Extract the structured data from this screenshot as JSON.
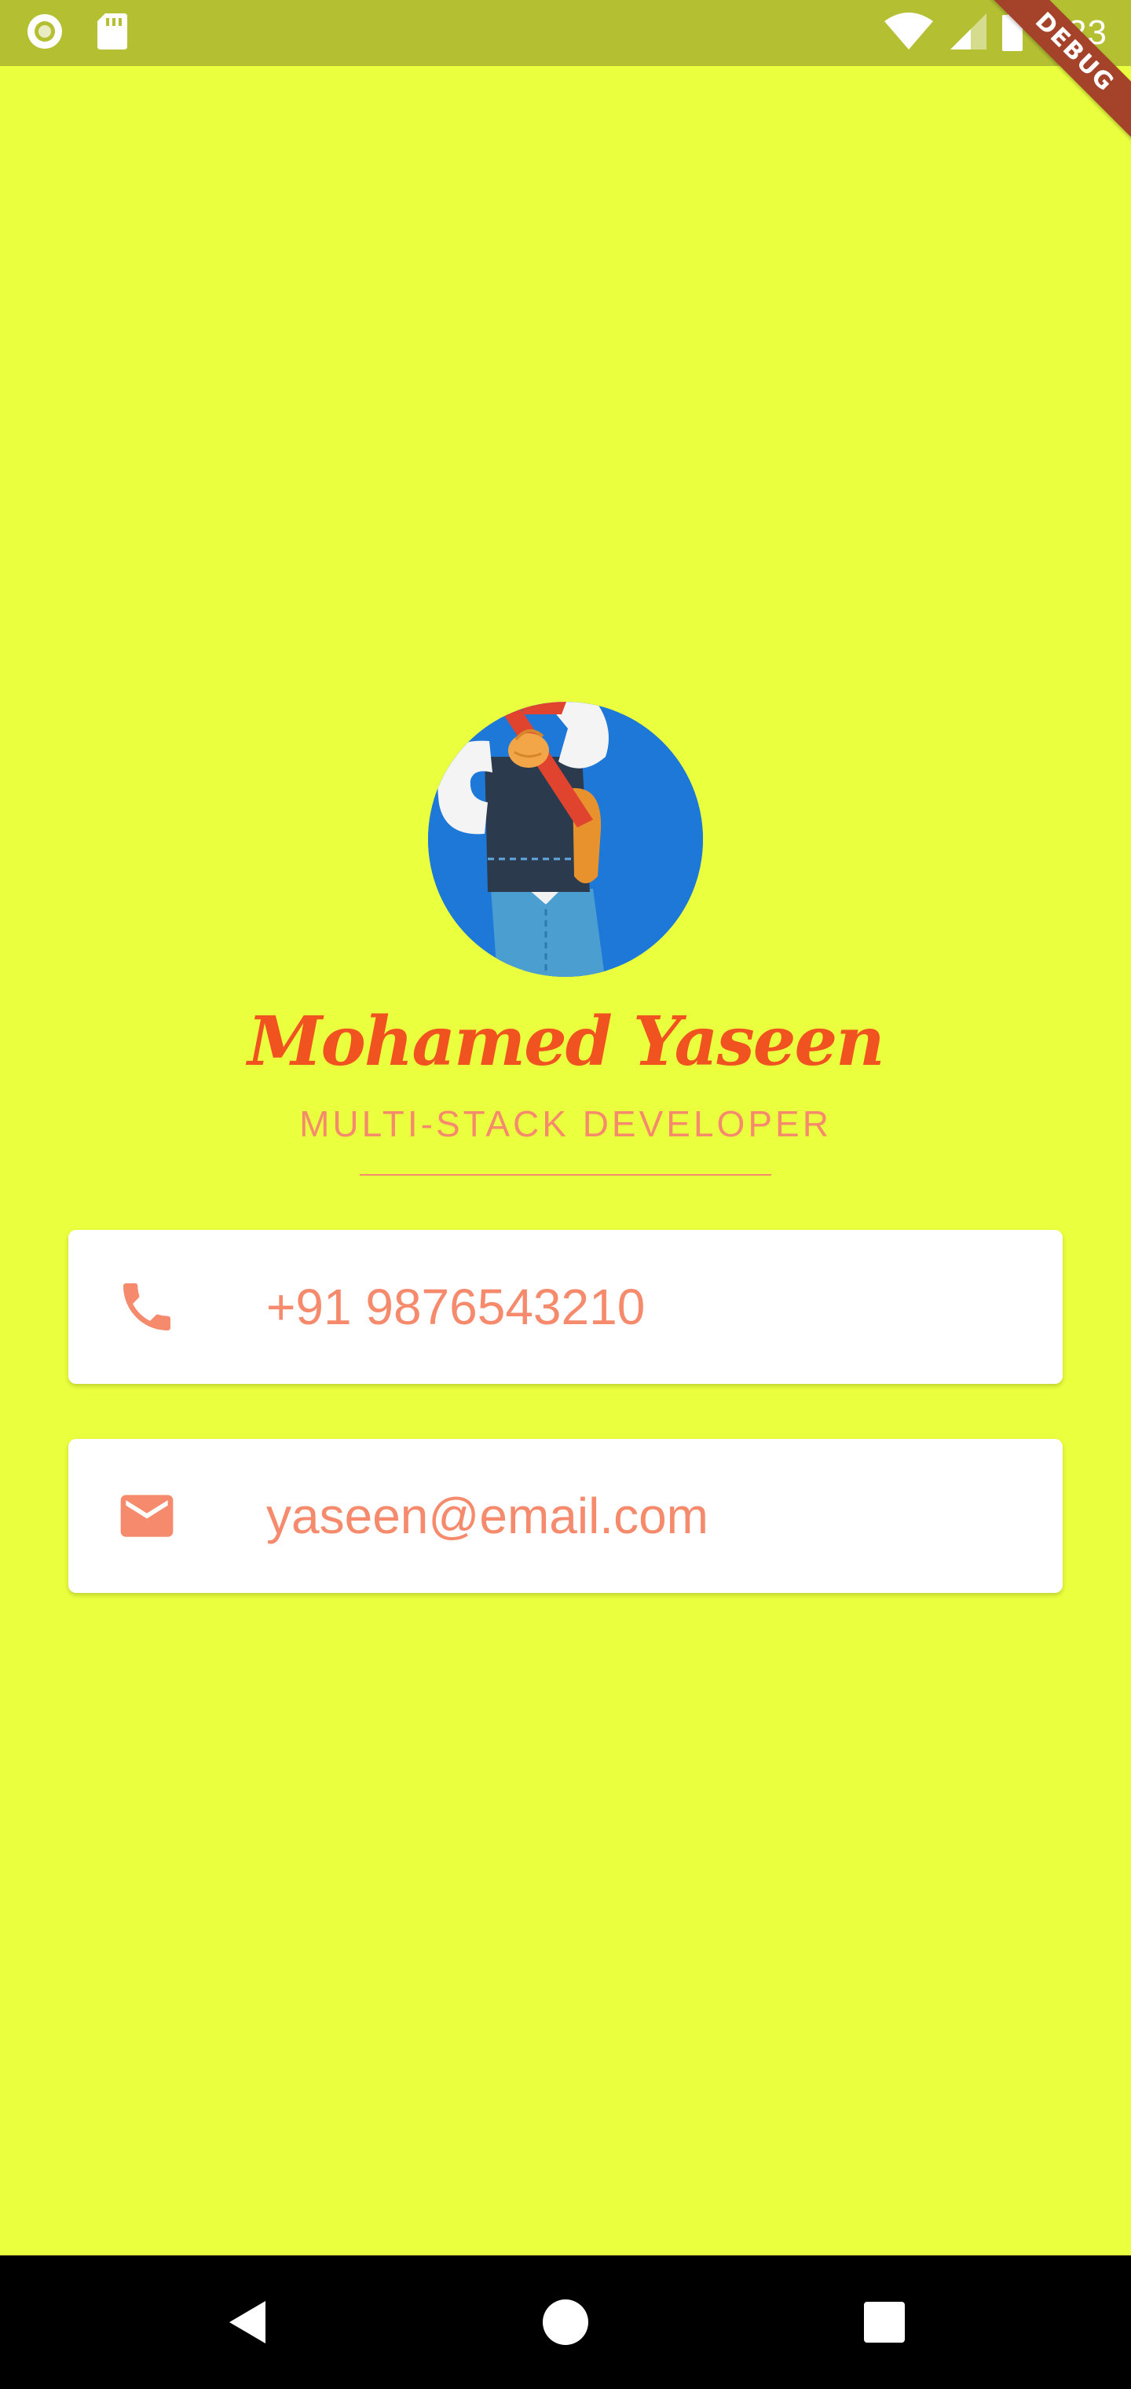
{
  "status_bar": {
    "time": "4:23",
    "left_icons": [
      "record-indicator-icon",
      "sd-card-icon"
    ],
    "right_icons": [
      "wifi-icon",
      "cell-signal-icon",
      "battery-icon"
    ]
  },
  "debug_banner": {
    "label": "DEBUG"
  },
  "profile": {
    "name": "Mohamed Yaseen",
    "title": "MULTI-STACK DEVELOPER",
    "avatar_icon": "profile-avatar-image"
  },
  "contacts": {
    "phone": {
      "icon": "phone-icon",
      "value": "+91 9876543210"
    },
    "email": {
      "icon": "email-icon",
      "value": "yaseen@email.com"
    }
  },
  "navigation": {
    "buttons": [
      "back-icon",
      "home-icon",
      "recents-icon"
    ]
  },
  "colors": {
    "background": "#EAFF3D",
    "status_bar": "#B4C032",
    "name": "#F05220",
    "accent": "#F58A6C",
    "card": "#FFFFFF",
    "nav_bar": "#000000",
    "avatar_background": "#1E78D8",
    "debug_ribbon": "#A4422A"
  }
}
